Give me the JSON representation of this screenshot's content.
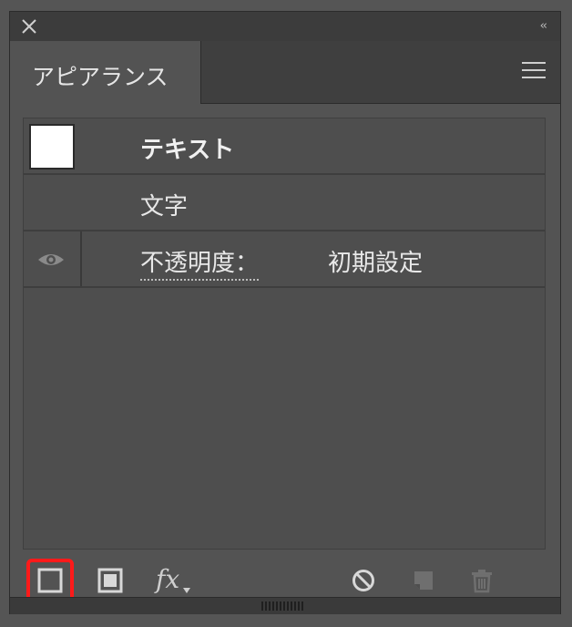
{
  "panel": {
    "title_bar": {
      "collapse_label": "‹‹"
    },
    "tab": {
      "label": "アピアランス"
    },
    "rows": [
      {
        "label": "テキスト"
      },
      {
        "label": "文字"
      },
      {
        "label": "不透明度：",
        "value": "初期設定"
      }
    ],
    "toolbar": {
      "icons": [
        "add-new-stroke-icon",
        "add-new-fill-icon",
        "fx-add-effect-icon",
        "clear-appearance-icon",
        "duplicate-item-icon",
        "delete-item-icon"
      ],
      "fx_label": "fx"
    }
  },
  "colors": {
    "panel_bg": "#535353",
    "highlight": "#ff1a1a"
  }
}
